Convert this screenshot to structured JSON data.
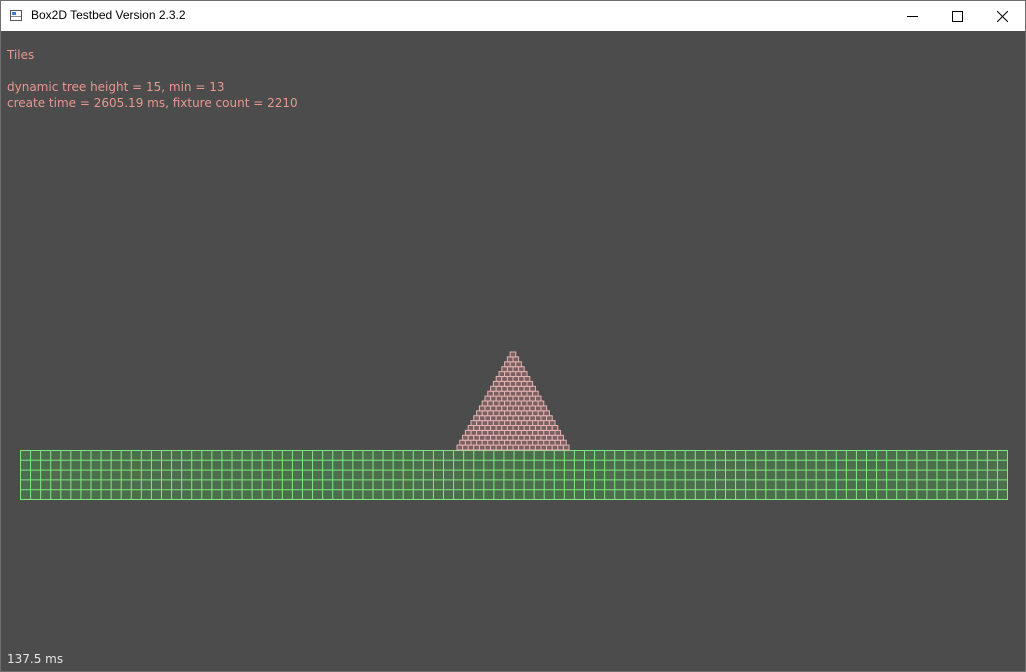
{
  "window": {
    "title": "Box2D Testbed Version 2.3.2",
    "minimize_icon": "minimize-icon",
    "maximize_icon": "maximize-icon",
    "close_icon": "close-icon"
  },
  "hud": {
    "test_name": "Tiles",
    "tree_info": "dynamic tree height = 15, min = 13",
    "create_info": "create time = 2605.19 ms, fixture count = 2210"
  },
  "footer": {
    "step_time": "137.5 ms"
  },
  "scene": {
    "background_color": "#4c4c4c",
    "ground": {
      "fill_color": "#4d6e4d",
      "grid_color": "#80e680",
      "columns": 98,
      "rows": 5
    },
    "pyramid": {
      "fill_color": "#7a6060",
      "outline_color": "#e6b3b3",
      "rows": 20
    }
  }
}
